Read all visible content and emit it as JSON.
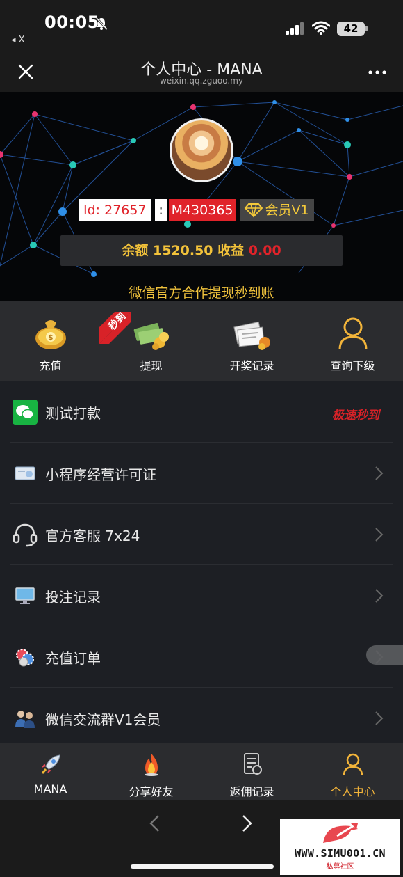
{
  "status": {
    "time": "00:05",
    "back_app": "◂ X",
    "battery": "42"
  },
  "titlebar": {
    "title": "个人中心 - MANA",
    "subtitle": "weixin.qq.zguoo.my"
  },
  "profile": {
    "id_label": "Id:",
    "id_value": "27657",
    "colon": ":",
    "code": "M430365",
    "vip": "会员V1",
    "balance_label": "余额",
    "balance_value": "1520.50",
    "income_label": "收益",
    "income_value": "0.00",
    "notice": "微信官方合作提现秒到账"
  },
  "quick_actions": [
    {
      "label": "充值",
      "icon": "money-bag-icon"
    },
    {
      "label": "提现",
      "icon": "cash-stack-icon",
      "badge": "秒到"
    },
    {
      "label": "开奖记录",
      "icon": "ticket-records-icon"
    },
    {
      "label": "查询下级",
      "icon": "user-outline-icon"
    }
  ],
  "menu": [
    {
      "label": "测试打款",
      "icon": "wechat-icon",
      "badge": "极速秒到"
    },
    {
      "label": "小程序经营许可证",
      "icon": "certificate-icon"
    },
    {
      "label": "官方客服 7x24",
      "icon": "headset-icon"
    },
    {
      "label": "投注记录",
      "icon": "monitor-icon"
    },
    {
      "label": "充值订单",
      "icon": "chips-icon"
    },
    {
      "label": "微信交流群V1会员",
      "icon": "group-icon"
    }
  ],
  "tabs": [
    {
      "label": "MANA",
      "icon": "rocket-icon"
    },
    {
      "label": "分享好友",
      "icon": "flame-icon"
    },
    {
      "label": "返佣记录",
      "icon": "document-icon"
    },
    {
      "label": "个人中心",
      "icon": "user-outline-icon",
      "active": true
    }
  ],
  "watermark": {
    "site": "WWW.SIMU001.CN",
    "sub": "私募社区"
  },
  "colors": {
    "gold": "#f2c23a",
    "red": "#e0232a",
    "active_tab": "#f2b43a"
  }
}
